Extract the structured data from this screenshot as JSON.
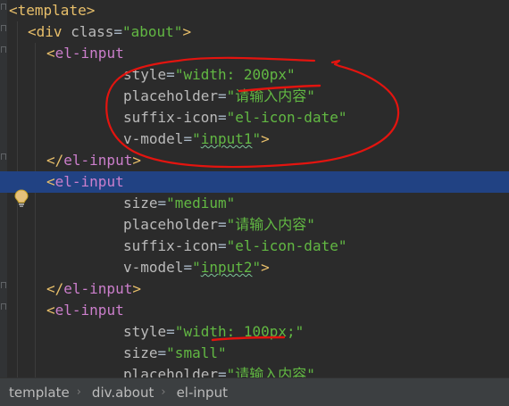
{
  "lines": [
    {
      "indent": 0,
      "open": "<",
      "tag": "template",
      "close": ">"
    },
    {
      "indent": 1,
      "open": "<",
      "tag": "div",
      "attr": "class",
      "value": "\"about\"",
      "close": ">"
    },
    {
      "indent": 2,
      "open": "<",
      "tag": "el-input"
    },
    {
      "indent": 4,
      "attr": "style",
      "value": "\"width: 200px\""
    },
    {
      "indent": 4,
      "attr": "placeholder",
      "value": "\"请输入内容\""
    },
    {
      "indent": 4,
      "attr": "suffix-icon",
      "value": "\"el-icon-date\""
    },
    {
      "indent": 4,
      "attr": "v-model",
      "value_pre": "\"",
      "value_u": "input1",
      "value_post": "\"",
      "close": ">"
    },
    {
      "indent": 2,
      "open": "</",
      "tag": "el-input",
      "close": ">"
    },
    {
      "indent": 2,
      "open": "<",
      "tag": "el-input"
    },
    {
      "indent": 4,
      "attr": "size",
      "value": "\"medium\""
    },
    {
      "indent": 4,
      "attr": "placeholder",
      "value": "\"请输入内容\""
    },
    {
      "indent": 4,
      "attr": "suffix-icon",
      "value": "\"el-icon-date\""
    },
    {
      "indent": 4,
      "attr": "v-model",
      "value_pre": "\"",
      "value_u": "input2",
      "value_post": "\"",
      "close": ">"
    },
    {
      "indent": 2,
      "open": "</",
      "tag": "el-input",
      "close": ">"
    },
    {
      "indent": 2,
      "open": "<",
      "tag": "el-input"
    },
    {
      "indent": 4,
      "attr": "style",
      "value": "\"width: 100px;\""
    },
    {
      "indent": 4,
      "attr": "size",
      "value": "\"small\""
    },
    {
      "indent": 4,
      "attr": "placeholder",
      "value": "\"请输入内容\""
    }
  ],
  "current_line": 8,
  "breadcrumb": [
    "template",
    "div.about",
    "el-input"
  ],
  "colors": {
    "background": "#2b2b2b",
    "tag": "#e8bf6a",
    "string": "#62b843",
    "selection": "#214283",
    "annotation": "#e3140f"
  }
}
